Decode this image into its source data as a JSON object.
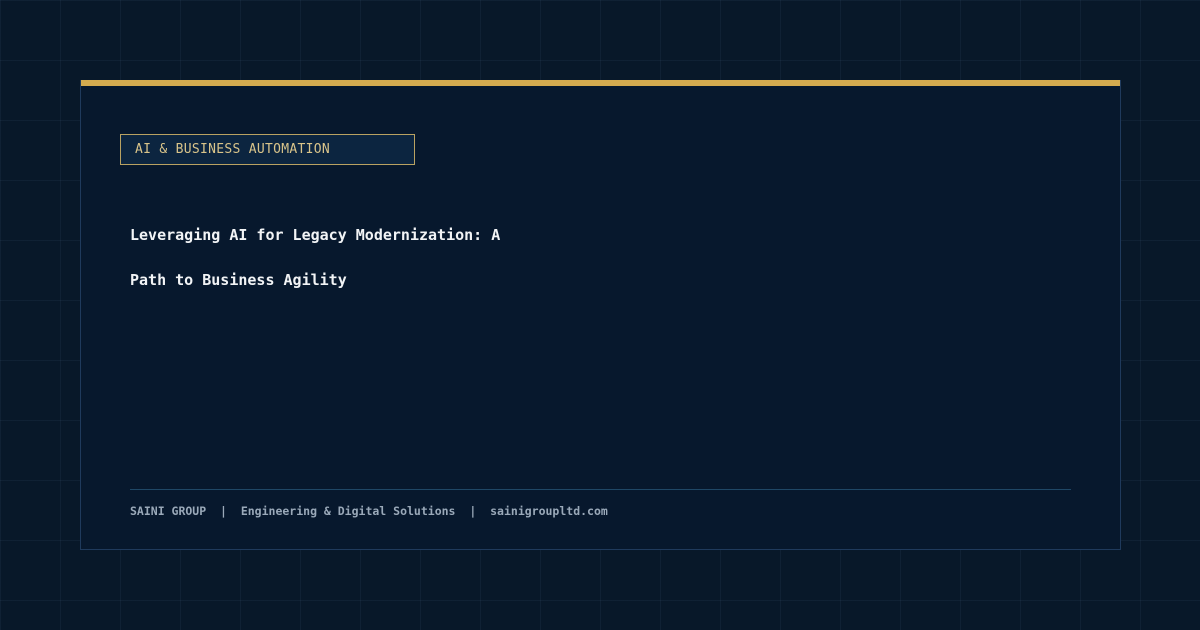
{
  "category": {
    "label": "AI & BUSINESS AUTOMATION"
  },
  "article": {
    "title_line_1": "Leveraging AI for Legacy Modernization: A",
    "title_line_2": "Path to Business Agility"
  },
  "footer": {
    "company": "SAINI GROUP",
    "separator": "|",
    "tagline": "Engineering & Digital Solutions",
    "website": "sainigroupltd.com"
  },
  "colors": {
    "background": "#081829",
    "card": "#07182d",
    "accent_gold": "#d4ab4f",
    "tag_text": "#d9c48a",
    "title_text": "#f2f4f6",
    "footer_text": "#9aa9b9"
  }
}
